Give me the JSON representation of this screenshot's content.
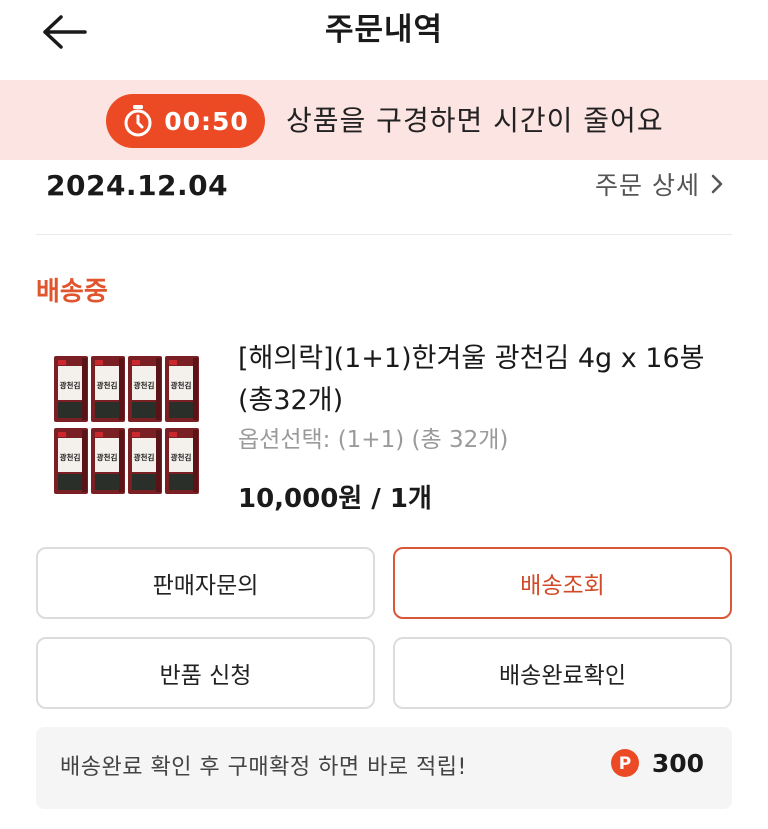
{
  "header": {
    "title": "주문내역",
    "back_icon": "back-arrow-icon"
  },
  "timer_banner": {
    "time": "00:50",
    "message": "상품을 구경하면 시간이 줄어요",
    "icon": "stopwatch-icon",
    "accent_color": "#ec4a25",
    "background_color": "#fbe4e2"
  },
  "order": {
    "date": "2024.12.04",
    "detail_label": "주문 상세",
    "detail_icon": "chevron-right-icon",
    "status": "배송중",
    "status_color": "#e0552e"
  },
  "product": {
    "title": "[해의락](1+1)한겨울 광천김 4g x 16봉 (총32개)",
    "option": "옵션선택: (1+1) (총 32개)",
    "price": "10,000원 / 1개",
    "thumbnail_label": "광천김",
    "thumbnail_icon": "seaweed-product-image"
  },
  "actions": {
    "seller_inquiry": "판매자문의",
    "track_delivery": "배송조회",
    "return_request": "반품 신청",
    "confirm_delivery": "배송완료확인"
  },
  "reward": {
    "message": "배송완료 확인 후 구매확정 하면 바로 적립!",
    "badge_letter": "P",
    "points": "300",
    "badge_icon": "point-coin-icon"
  }
}
